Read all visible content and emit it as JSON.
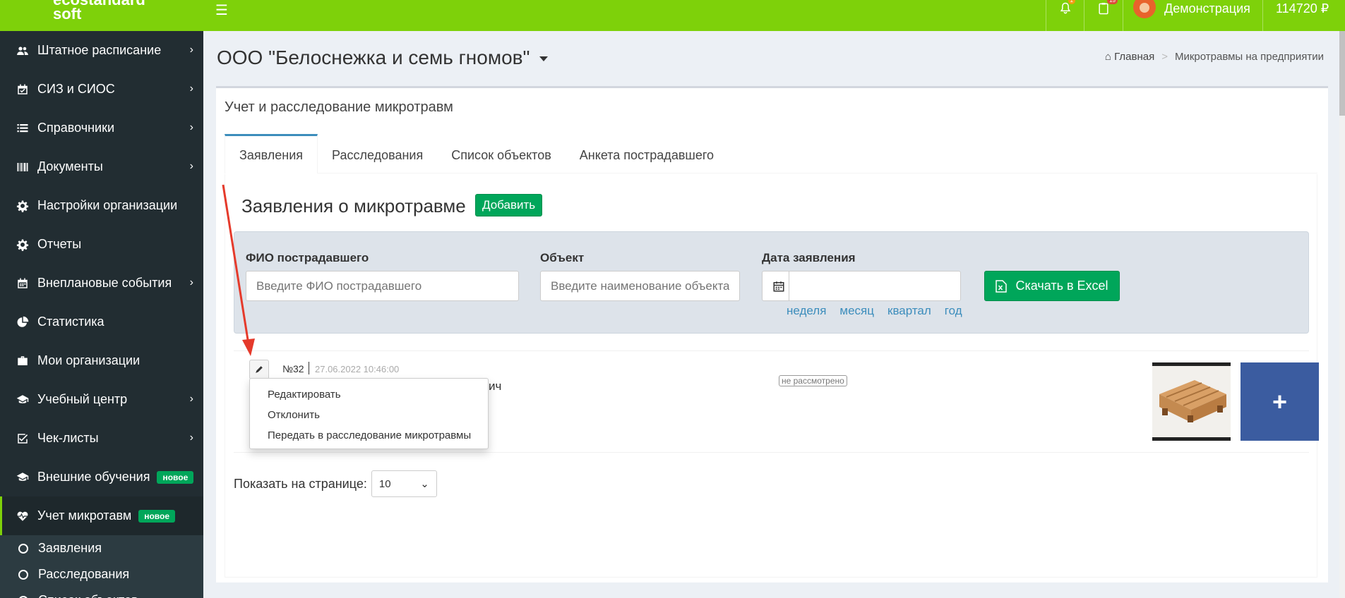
{
  "app": {
    "logo_line1": "ecostandard",
    "logo_line2": "soft",
    "notifications_badge": "1",
    "tasks_badge": "15",
    "user_name": "Демонстрация",
    "balance": "114720 ₽",
    "brand_color": "#7ed10a"
  },
  "sidebar": {
    "items": [
      {
        "label": "Штатное расписание",
        "icon": "users-icon",
        "has_submenu": true
      },
      {
        "label": "СИЗ и СИОС",
        "icon": "calendar-check-icon",
        "has_submenu": true
      },
      {
        "label": "Справочники",
        "icon": "list-icon",
        "has_submenu": true
      },
      {
        "label": "Документы",
        "icon": "barcode-icon",
        "has_submenu": true
      },
      {
        "label": "Настройки организации",
        "icon": "gear-icon",
        "has_submenu": false
      },
      {
        "label": "Отчеты",
        "icon": "gear-icon",
        "has_submenu": false
      },
      {
        "label": "Внеплановые события",
        "icon": "calendar-icon",
        "has_submenu": true
      },
      {
        "label": "Статистика",
        "icon": "pie-chart-icon",
        "has_submenu": false
      },
      {
        "label": "Мои организации",
        "icon": "briefcase-icon",
        "has_submenu": false
      },
      {
        "label": "Учебный центр",
        "icon": "graduation-cap-icon",
        "has_submenu": true
      },
      {
        "label": "Чек-листы",
        "icon": "checkbox-icon",
        "has_submenu": true
      },
      {
        "label": "Внешние обучения",
        "icon": "graduation-cap-icon",
        "badge": "новое"
      },
      {
        "label": "Учет микротавм",
        "icon": "heartbeat-icon",
        "badge": "новое",
        "active": true
      }
    ],
    "subitems": [
      {
        "label": "Заявления"
      },
      {
        "label": "Расследования"
      },
      {
        "label": "Список объектов"
      }
    ]
  },
  "header": {
    "org_name": "ООО \"Белоснежка и семь гномов\"",
    "breadcrumb_home": "Главная",
    "breadcrumb_sep": ">",
    "breadcrumb_current": "Микротравмы на предприятии"
  },
  "box": {
    "title": "Учет и расследование микротравм",
    "tabs": [
      "Заявления",
      "Расследования",
      "Список объектов",
      "Анкета пострадавшего"
    ],
    "active_tab": "Заявления"
  },
  "section": {
    "heading": "Заявления о микротравме",
    "add_label": "Добавить"
  },
  "filters": {
    "fio_label": "ФИО пострадавшего",
    "fio_placeholder": "Введите ФИО пострадавшего",
    "fio_value": "",
    "object_label": "Объект",
    "object_placeholder": "Введите наименование объекта",
    "object_value": "",
    "date_label": "Дата заявления",
    "date_value": "",
    "periods": [
      "неделя",
      "месяц",
      "квартал",
      "год"
    ],
    "excel_label": "Скачать в Excel"
  },
  "record": {
    "number": "№32",
    "date": "27.06.2022 10:46:00",
    "name_tail": "ич",
    "status": "не рассмотрено"
  },
  "dropdown": {
    "items": [
      "Редактировать",
      "Отклонить",
      "Передать в расследование микротравмы"
    ]
  },
  "pagination": {
    "label": "Показать на странице:",
    "per_page": "10"
  }
}
